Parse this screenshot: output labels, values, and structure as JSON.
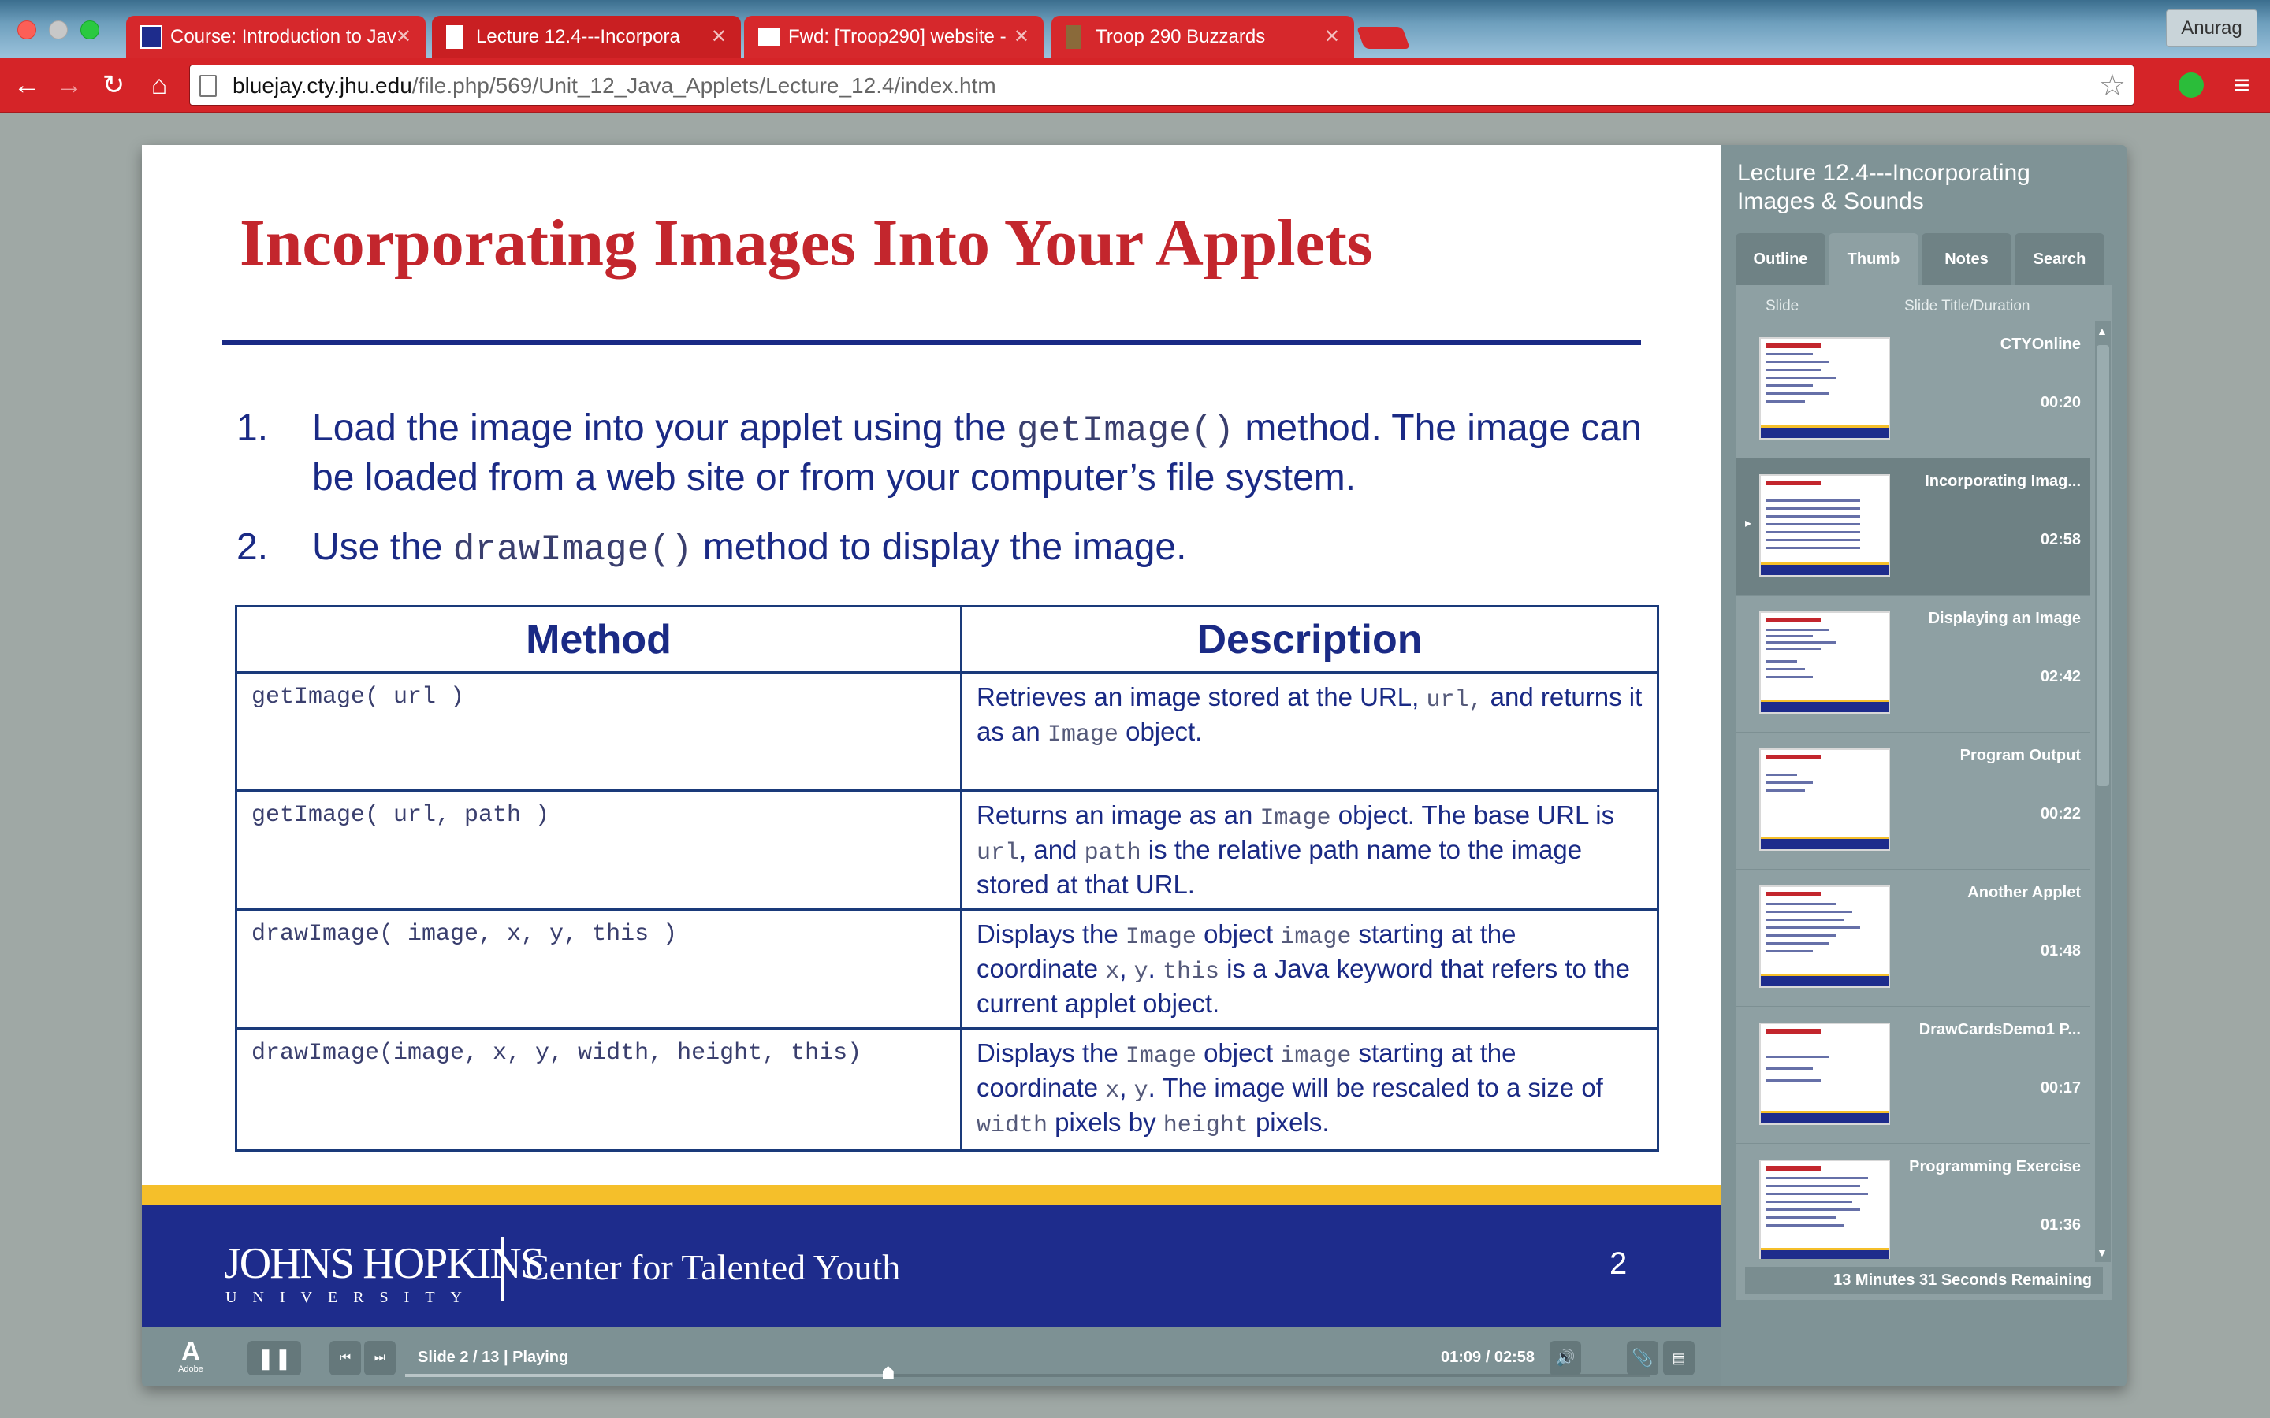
{
  "browser": {
    "tabs": [
      {
        "label": "Course: Introduction to Jav",
        "icon": "jhu-cty-favicon"
      },
      {
        "label": "Lecture 12.4---Incorpora",
        "icon": "page-icon"
      },
      {
        "label": "Fwd: [Troop290] website -",
        "icon": "gmail-icon"
      },
      {
        "label": "Troop 290 Buzzards",
        "icon": "scout-favicon"
      }
    ],
    "profile": "Anurag",
    "url_host": "bluejay.cty.jhu.edu",
    "url_path": "/file.php/569/Unit_12_Java_Applets/Lecture_12.4/index.htm",
    "accent_color": "#d52428"
  },
  "slide": {
    "title": "Incorporating Images Into Your Applets",
    "bullets": [
      {
        "num": "1.",
        "pre": "Load the image into your applet using the ",
        "code": "getImage()",
        "post": " method. The image can be loaded from a web site or from your computer’s file system."
      },
      {
        "num": "2.",
        "pre": "Use the ",
        "code": "drawImage()",
        "post": " method to display the image."
      }
    ],
    "table": {
      "headers": [
        "Method",
        "Description"
      ],
      "rows": [
        {
          "sig": "getImage( url )",
          "desc": [
            [
              "Retrieves an image stored at the URL, ",
              false
            ],
            [
              "url,",
              true
            ],
            [
              " and returns it as an ",
              false
            ],
            [
              "Image",
              true
            ],
            [
              " object.",
              false
            ]
          ]
        },
        {
          "sig": "getImage( url, path )",
          "desc": [
            [
              "Returns an image as an ",
              false
            ],
            [
              "Image",
              true
            ],
            [
              " object. The base URL is ",
              false
            ],
            [
              "url",
              true
            ],
            [
              ", and ",
              false
            ],
            [
              "path",
              true
            ],
            [
              " is the relative path name to the image stored at that URL.",
              false
            ]
          ]
        },
        {
          "sig": "drawImage( image, x, y, this )",
          "desc": [
            [
              "Displays the ",
              false
            ],
            [
              "Image",
              true
            ],
            [
              " object ",
              false
            ],
            [
              "image",
              true
            ],
            [
              " starting at the coordinate ",
              false
            ],
            [
              "x",
              true
            ],
            [
              ", ",
              false
            ],
            [
              "y",
              true
            ],
            [
              ". ",
              false
            ],
            [
              "this",
              true
            ],
            [
              " is a Java keyword that refers to the current applet object.",
              false
            ]
          ]
        },
        {
          "sig": "drawImage(image, x, y, width, height, this)",
          "desc": [
            [
              "Displays the ",
              false
            ],
            [
              "Image",
              true
            ],
            [
              " object ",
              false
            ],
            [
              "image",
              true
            ],
            [
              " starting at the coordinate ",
              false
            ],
            [
              "x",
              true
            ],
            [
              ", ",
              false
            ],
            [
              "y",
              true
            ],
            [
              ". The image will be rescaled to a size of ",
              false
            ],
            [
              "width",
              true
            ],
            [
              " pixels by ",
              false
            ],
            [
              "height",
              true
            ],
            [
              " pixels.",
              false
            ]
          ]
        }
      ]
    },
    "footer": {
      "jhu_name": "JOHNS HOPKINS",
      "jhu_sub": "UNIVERSITY",
      "cty_name": "Center for Talented Youth",
      "page_number": "2"
    }
  },
  "sidebar": {
    "title": "Lecture 12.4---Incorporating Images & Sounds",
    "tabs": [
      "Outline",
      "Thumb",
      "Notes",
      "Search"
    ],
    "active_tab": "Thumb",
    "col_slide": "Slide",
    "col_title": "Slide Title/Duration",
    "thumbs": [
      {
        "title": "CTYOnline",
        "duration": "00:20"
      },
      {
        "title": "Incorporating Imag...",
        "duration": "02:58"
      },
      {
        "title": "Displaying an Image",
        "duration": "02:42"
      },
      {
        "title": "Program Output",
        "duration": "00:22"
      },
      {
        "title": "Another Applet",
        "duration": "01:48"
      },
      {
        "title": "DrawCardsDemo1 P...",
        "duration": "00:17"
      },
      {
        "title": "Programming Exercise",
        "duration": "01:36"
      }
    ],
    "current_index": 1,
    "remaining": "13 Minutes 31 Seconds Remaining"
  },
  "playbar": {
    "adobe": "Adobe",
    "status": "Slide 2 / 13 | Playing",
    "time": "01:09 / 02:58",
    "progress": 0.3878
  }
}
